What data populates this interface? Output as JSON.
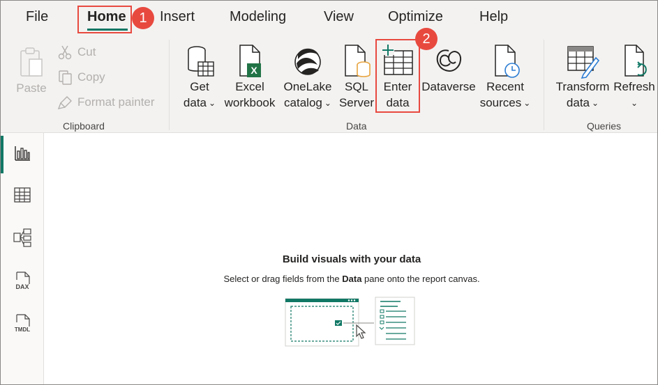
{
  "menu": {
    "tabs": [
      {
        "label": "File"
      },
      {
        "label": "Home"
      },
      {
        "label": "Insert"
      },
      {
        "label": "Modeling"
      },
      {
        "label": "View"
      },
      {
        "label": "Optimize"
      },
      {
        "label": "Help"
      }
    ],
    "active_tab": "Home"
  },
  "ribbon": {
    "clipboard": {
      "paste": "Paste",
      "cut": "Cut",
      "copy": "Copy",
      "format_painter": "Format painter",
      "group_label": "Clipboard"
    },
    "data": {
      "get_data": [
        "Get",
        "data"
      ],
      "excel": [
        "Excel",
        "workbook"
      ],
      "onelake": [
        "OneLake",
        "catalog"
      ],
      "sql": [
        "SQL",
        "Server"
      ],
      "enter_data": [
        "Enter",
        "data"
      ],
      "dataverse": "Dataverse",
      "recent": [
        "Recent",
        "sources"
      ],
      "group_label": "Data"
    },
    "queries": {
      "transform": [
        "Transform",
        "data"
      ],
      "refresh": "Refresh",
      "group_label": "Queries"
    }
  },
  "callouts": [
    "1",
    "2"
  ],
  "leftnav": {
    "items": [
      {
        "icon": "report-view-icon",
        "active": true
      },
      {
        "icon": "table-view-icon"
      },
      {
        "icon": "model-view-icon"
      },
      {
        "icon": "dax-query-view-icon",
        "text": "DAX"
      },
      {
        "icon": "tmdl-view-icon",
        "text": "TMDL"
      }
    ]
  },
  "canvas": {
    "title": "Build visuals with your data",
    "desc_before": "Select or drag fields from the ",
    "desc_bold": "Data",
    "desc_after": " pane onto the report canvas."
  },
  "colors": {
    "accent": "#117865",
    "callout": "#e8493f",
    "excel_green": "#217346",
    "sql_orange": "#e8a33d"
  }
}
